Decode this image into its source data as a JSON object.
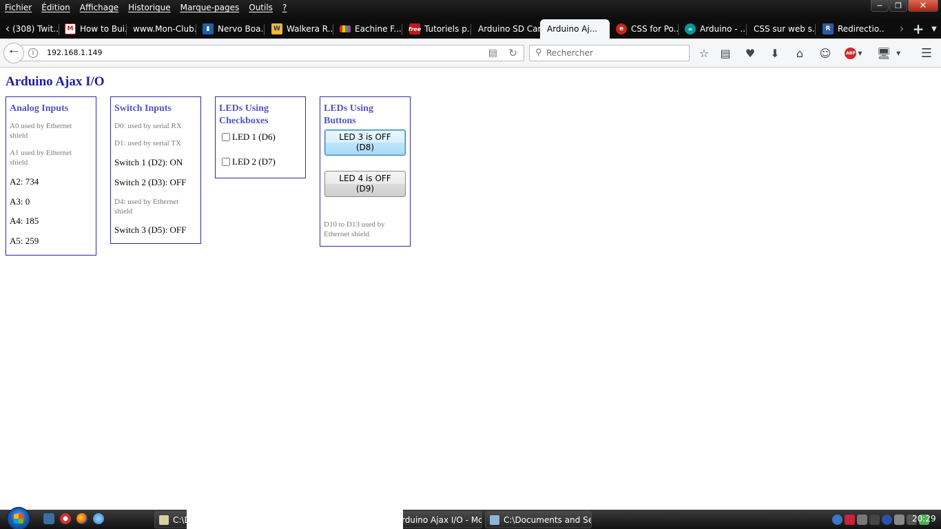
{
  "menubar": {
    "items": [
      "Fichier",
      "Édition",
      "Affichage",
      "Historique",
      "Marque-pages",
      "Outils",
      "?"
    ]
  },
  "tabs": [
    {
      "label": "(308) Twit...",
      "icon": "twitter-icon",
      "color": ""
    },
    {
      "label": "How to Bui...",
      "icon": "makezine-icon",
      "color": "#d8131f"
    },
    {
      "label": "www.Mon-Club...",
      "icon": "",
      "color": ""
    },
    {
      "label": "Nervo Boa...",
      "icon": "nervo-icon",
      "color": "#1d5fa8"
    },
    {
      "label": "Walkera R...",
      "icon": "walkera-icon",
      "color": "#f2b830"
    },
    {
      "label": "Eachine F...",
      "icon": "eachine-icon",
      "color": "#a34fb8"
    },
    {
      "label": "Tutoriels p...",
      "icon": "free-icon",
      "color": "#c8151b"
    },
    {
      "label": "Arduino SD Car...",
      "icon": "",
      "color": ""
    },
    {
      "label": "Arduino Aj...",
      "icon": "",
      "color": "",
      "active": true
    },
    {
      "label": "CSS for Po...",
      "icon": "css-icon",
      "color": "#c9241b"
    },
    {
      "label": "Arduino - ...",
      "icon": "arduino-icon",
      "color": "#00979c"
    },
    {
      "label": "CSS sur web s...",
      "icon": "",
      "color": ""
    },
    {
      "label": "Redirectio...",
      "icon": "redirect-icon",
      "color": "#2c5aa8"
    }
  ],
  "navbar": {
    "url": "192.168.1.149",
    "search_placeholder": "Rechercher"
  },
  "page": {
    "title": "Arduino Ajax I/O",
    "analog": {
      "heading": "Analog Inputs",
      "a0_note": "A0 used by Ethernet shield",
      "a1_note": "A1 used by Ethernet shield",
      "readings": [
        "A2: 734",
        "A3: 0",
        "A4: 185",
        "A5: 259"
      ]
    },
    "switches": {
      "heading": "Switch Inputs",
      "d0_note": "D0: used by serial RX",
      "d1_note": "D1: used by serial TX",
      "switch1": "Switch 1 (D2): ON",
      "switch2": "Switch 2 (D3): OFF",
      "d4_note": "D4: used by Ethernet shield",
      "switch3": "Switch 3 (D5): OFF"
    },
    "led_checkboxes": {
      "heading": "LEDs Using Checkboxes",
      "led1": "LED 1 (D6)",
      "led2": "LED 2 (D7)",
      "led1_checked": false,
      "led2_checked": false
    },
    "led_buttons": {
      "heading": "LEDs Using Buttons",
      "led3": "LED 3 is OFF (D8)",
      "led4": "LED 4 is OFF (D9)",
      "note": "D10 to D13 used by Ethernet shield"
    }
  },
  "taskbar": {
    "task1": "C:\\D",
    "task2": "rduino Ajax I/O - Mo...",
    "task3": "C:\\Documents and Set...",
    "clock": "20:29"
  },
  "colors": {
    "page_title": "#1c1ca6",
    "box_border": "#2a2aa5",
    "box_heading": "#5252c4",
    "note_text": "#7a7a7a"
  }
}
